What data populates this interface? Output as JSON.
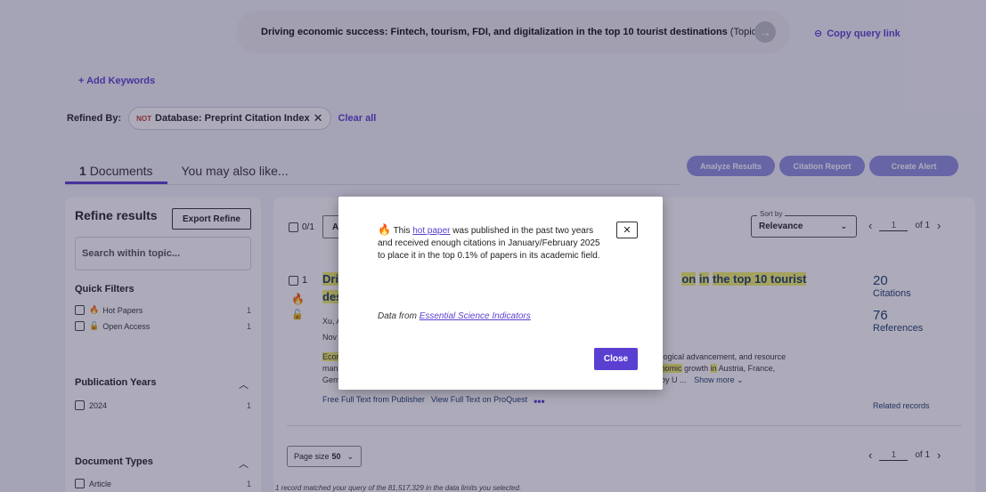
{
  "query": {
    "text": "Driving economic success: Fintech, tourism, FDI, and digitalization in the top 10 tourist destinations",
    "type": "(Topic)",
    "go_icon": "arrow-right-icon",
    "copy_link": "Copy query link"
  },
  "add_keywords": "+  Add Keywords",
  "refined": {
    "label": "Refined By:",
    "chip_not": "NOT",
    "chip_value": "Database: Preprint Citation Index",
    "clear_all": "Clear all"
  },
  "tabs": {
    "documents_count": "1",
    "documents_label": "Documents",
    "also_like": "You may also like..."
  },
  "actions": {
    "analyze": "Analyze Results",
    "citation_report": "Citation Report",
    "create_alert": "Create Alert"
  },
  "sidebar": {
    "title": "Refine results",
    "export": "Export Refine",
    "search_placeholder": "Search within topic...",
    "quick_filters": "Quick Filters",
    "hot_papers": "Hot Papers",
    "hot_papers_count": "1",
    "open_access": "Open Access",
    "open_access_count": "1",
    "pub_years": "Publication Years",
    "year_2024": "2024",
    "year_2024_count": "1",
    "doc_types": "Document Types",
    "article": "Article",
    "article_count": "1"
  },
  "results": {
    "selected": "0/1",
    "sort_legend": "Sort by",
    "sort_value": "Relevance",
    "page": "1",
    "of_pages": "of 1",
    "record_num": "1",
    "title_frag1": "Dri",
    "title_frag2": "on",
    "title_frag3": "in",
    "title_frag4": "the top 10 tourist",
    "title_line2": "des",
    "authors_frag": "Xu, A",
    "date_frag": "Nov",
    "abs1a": "Econ",
    "abs1b": "ological advancement, and resource",
    "abs2a": "man",
    "abs2b": "onomic",
    "abs2c": "growth",
    "abs2d": "in",
    "abs2e": "Austria, France,",
    "abs3a": "Gern",
    "abs3b": "by U ...",
    "show_more": "Show more",
    "free_full_text": "Free Full Text from Publisher",
    "view_proquest": "View Full Text on ProQuest",
    "citations_num": "20",
    "citations_label": "Citations",
    "references_num": "76",
    "references_label": "References",
    "related": "Related records",
    "page_size_label": "Page size",
    "page_size_value": "50",
    "footnote": "1 record matched your query of the 81,517,329 in the data limits you selected."
  },
  "modal": {
    "text_pre": "This",
    "hot_paper_link": "hot paper",
    "text_post": "was published in the past two years and received enough citations in January/February 2025 to place it in the top 0.1% of papers in its academic field.",
    "data_from": "Data from",
    "esi_link": "Essential Science Indicators",
    "close": "Close"
  },
  "colors": {
    "accent": "#5b3fd1",
    "pill": "#8f8ee0",
    "hot": "#c0123a"
  }
}
